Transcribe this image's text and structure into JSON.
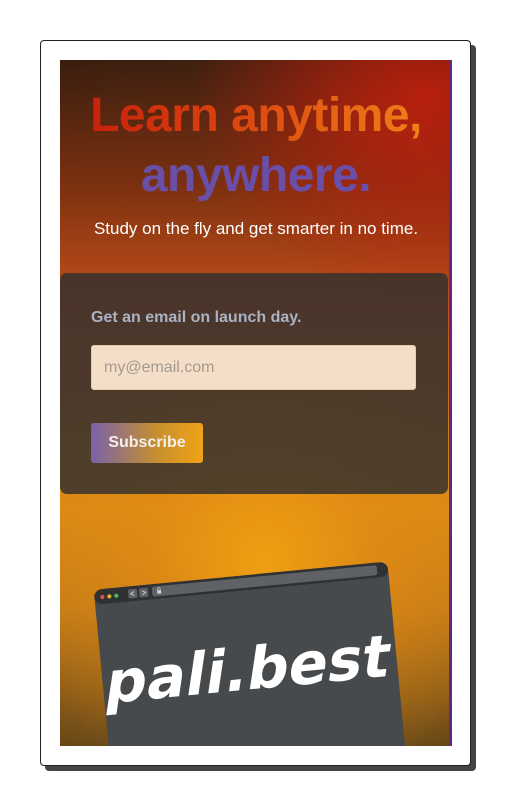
{
  "hero": {
    "headline_line1": "Learn anytime,",
    "headline_line2": "anywhere.",
    "subtitle": "Study on the fly and get smarter in no time."
  },
  "signup": {
    "label": "Get an email on launch day.",
    "email_placeholder": "my@email.com",
    "email_value": "",
    "subscribe_label": "Subscribe"
  },
  "preview": {
    "logo_text": "pali.best",
    "window_dots": [
      "#e8543a",
      "#e8b43a",
      "#4cbf5a"
    ],
    "nav_icons": [
      "back-arrow-icon",
      "forward-arrow-icon"
    ],
    "address_icon": "lock-icon"
  },
  "colors": {
    "headline_purple": "#6a4fa8",
    "card_bg": "#303030",
    "input_bg": "#f4dec8",
    "button_gradient_start": "#7a62a8",
    "button_gradient_end": "#f0a218"
  }
}
